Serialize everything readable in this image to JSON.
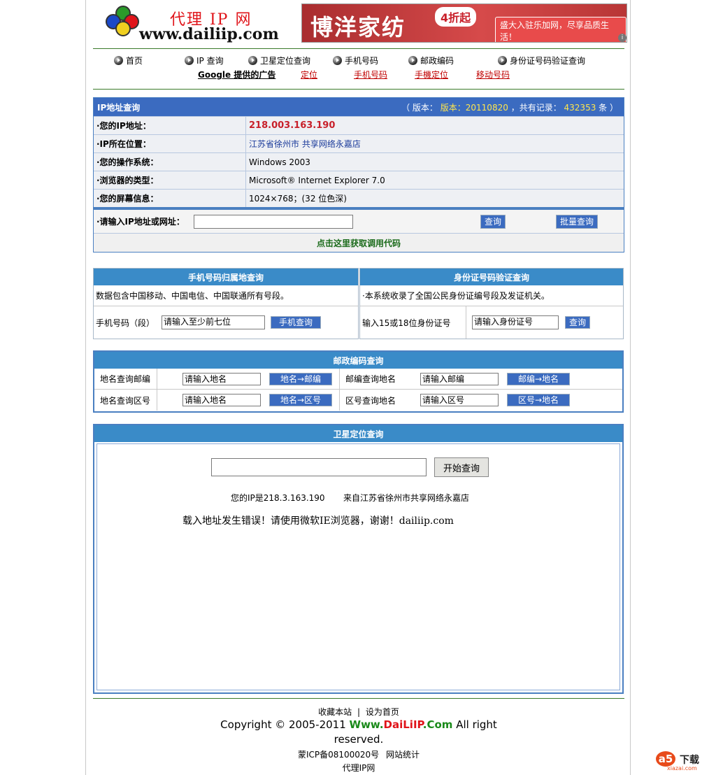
{
  "header": {
    "logo_title": "代理 IP 网",
    "logo_url": "www.dailiip.com",
    "banner_title": "博洋家纺",
    "banner_badge": "4折起",
    "banner_slogan": "盛大入驻乐加网，尽享品质生活！",
    "banner_info_icon": "i"
  },
  "nav": {
    "items": [
      {
        "label": "首页"
      },
      {
        "label": "IP 查询"
      },
      {
        "label": "卫星定位查询"
      },
      {
        "label": "手机号码"
      },
      {
        "label": "邮政编码"
      },
      {
        "label": "身份证号码验证查询"
      }
    ],
    "ads_label": "Google 提供的广告",
    "ad_links": [
      "定位",
      "手机号码",
      "手機定位",
      "移动号码"
    ]
  },
  "ip_table": {
    "title": "IP地址查询",
    "version_prefix": "（ 版本：",
    "version_value": "版本：20110820",
    "records_prefix": "，共有记录：",
    "records_value": "432353",
    "records_suffix": "条 ）",
    "rows": [
      {
        "key": "·您的IP地址：",
        "value": "218.003.163.190"
      },
      {
        "key": "·IP所在位置：",
        "value": "江苏省徐州市 共享网络永嘉店"
      },
      {
        "key": "·您的操作系统：",
        "value": "Windows 2003"
      },
      {
        "key": "·浏览器的类型：",
        "value": "Microsoft® Internet Explorer 7.0"
      },
      {
        "key": "·您的屏幕信息：",
        "value": "1024×768；(32 位色深)"
      }
    ],
    "input_label": "·请输入IP地址或网址：",
    "input_value": "",
    "query_button": "查询",
    "batch_button": "批量查询",
    "code_link": "点击这里获取调用代码"
  },
  "phone": {
    "title": "手机号码归属地查询",
    "desc": "数据包含中国移动、中国电信、中国联通所有号段。",
    "label": "手机号码（段）",
    "placeholder": "请输入至少前七位",
    "button": "手机查询"
  },
  "idcard": {
    "title": "身份证号码验证查询",
    "desc": "·本系统收录了全国公民身份证编号段及发证机关。",
    "label": "输入15或18位身份证号",
    "placeholder": "请输入身份证号",
    "button": "查询"
  },
  "postal": {
    "title": "邮政编码查询",
    "rows": [
      {
        "label1": "地名查询邮编",
        "ph1": "请输入地名",
        "btn1": "地名→邮编",
        "label2": "邮编查询地名",
        "ph2": "请输入邮编",
        "btn2": "邮编→地名"
      },
      {
        "label1": "地名查询区号",
        "ph1": "请输入地名",
        "btn1": "地名→区号",
        "label2": "区号查询地名",
        "ph2": "请输入区号",
        "btn2": "区号→地名"
      }
    ]
  },
  "satellite": {
    "title": "卫星定位查询",
    "input_value": "",
    "button": "开始查询",
    "ip_line": "您的IP是218.3.163.190",
    "from_line": "来自江苏省徐州市共享网络永嘉店",
    "error_msg": "载入地址发生错误！请使用微软IE浏览器，谢谢！dailiip.com"
  },
  "footer": {
    "bookmark": "收藏本站",
    "sep": "|",
    "homepage": "设为首页",
    "copyright_pre": "Copyright © 2005-2011 ",
    "copyright_site_1": "Www.",
    "copyright_site_2": "DaiLiIP",
    "copyright_site_3": ".Com",
    "copyright_post": " All right reserved.",
    "icp": "蒙ICP备08100020号",
    "stats": "网站统计",
    "site_name": "代理IP网"
  },
  "watermark": {
    "brand": "下载",
    "sub": "xiazai.com"
  },
  "colors": {
    "table_header": "#3b6bc0",
    "section_header": "#3a8bc8",
    "ip_value": "#c8202a",
    "link_blue": "#1a3a9a",
    "link_green": "#1a6a1a",
    "ad_red": "#c00000"
  }
}
